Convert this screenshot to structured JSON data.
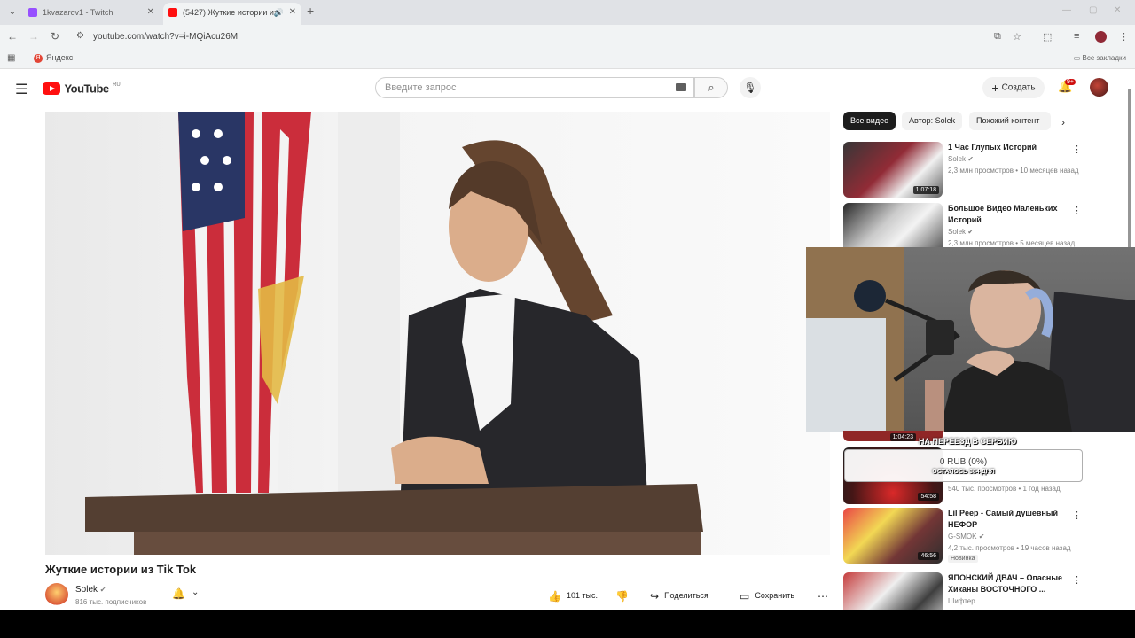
{
  "browser": {
    "tabs": [
      {
        "title": "1kvazarov1 - Twitch",
        "favicon_color": "#9146ff"
      },
      {
        "title": "(5427) Жуткие истории из",
        "favicon_color": "#ff0000"
      }
    ],
    "url": "youtube.com/watch?v=i-MQiAcu26M",
    "bookmarks": {
      "yandex": "Яндекс",
      "all": "Все закладки"
    }
  },
  "youtube": {
    "logo_word": "YouTube",
    "logo_region": "RU",
    "search_placeholder": "Введите запрос",
    "create_label": "Создать",
    "notifications_badge": "9+"
  },
  "video": {
    "title": "Жуткие истории из Tik Tok",
    "channel": "Solek",
    "subscribers": "816 тыс. подписчиков",
    "likes": "101 тыс.",
    "share_label": "Поделиться",
    "save_label": "Сохранить"
  },
  "chips": [
    "Все видео",
    "Автор: Solek",
    "Похожий контент"
  ],
  "recommendations": [
    {
      "title": "1 Час Глупых Историй",
      "channel": "Solek",
      "meta": "2,3 млн просмотров • 10 месяцев назад",
      "duration": "1:07:18"
    },
    {
      "title": "Большое Видео Маленьких Историй",
      "channel": "Solek",
      "meta": "2,3 млн просмотров • 5 месяцев назад",
      "duration": ""
    },
    {
      "title": "",
      "channel": "",
      "meta": "540 тыс. просмотров • 1 год назад",
      "duration": "54:58"
    },
    {
      "title": "Lil Peep - Самый душевный НЕФОР",
      "channel": "G-SMOK",
      "meta": "4,2 тыс. просмотров • 19 часов назад",
      "duration": "46:56",
      "badge": "Новинка"
    },
    {
      "title": "ЯПОНСКИЙ ДВАЧ – Опасные Хиканы ВОСТОЧНОГО ...",
      "channel": "Шифтер",
      "meta": "",
      "duration": ""
    }
  ],
  "overlay": {
    "hidden_duration": "1:04:23",
    "donation_title": "НА ПЕРЕЕЗД В СЕРБИЮ",
    "donation_amount": "0 RUB (0%)",
    "donation_left": "ОСТАЛОСЬ 384 ДНЯ"
  },
  "icons": [
    "menu-icon",
    "search-icon",
    "mic-icon",
    "bell-icon",
    "like-icon",
    "dislike-icon",
    "share-icon",
    "save-icon",
    "more-icon"
  ]
}
